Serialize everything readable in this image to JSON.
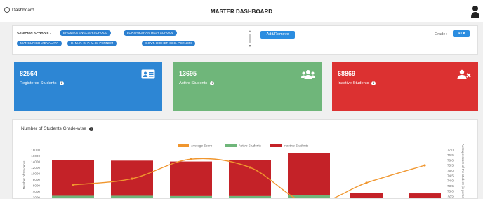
{
  "header": {
    "breadcrumb": "Dashboard",
    "title": "MASTER DASHBOARD",
    "breadcrumb_icon": "dashboard-icon",
    "avatar_icon": "user-avatar-icon"
  },
  "filter": {
    "selected_label": "Selected Schools -",
    "schools": [
      "BHUMIKA ENGLISH SCHOOL",
      "LOKSHIKSHAN HIGH SCHOOL",
      "MANGURISH VIDYALAYA",
      "H. M. P. G. P. M. S. PERNEM",
      "GOVT. HIGHER SEC. PERNEM"
    ],
    "add_remove_label": "Add/Remove",
    "grade_label": "Grade :",
    "grade_value": "All"
  },
  "cards": [
    {
      "value": "82564",
      "label": "Registered Students",
      "icon": "id-card-icon",
      "color": "#2d86d4"
    },
    {
      "value": "13695",
      "label": "Active Students",
      "icon": "users-group-icon",
      "color": "#6fb67a"
    },
    {
      "value": "68869",
      "label": "Inactive Students",
      "icon": "user-remove-icon",
      "color": "#dc3131"
    }
  ],
  "chart_panel": {
    "title": "Number of Students Grade-wise"
  },
  "chart_data": {
    "type": "bar",
    "legend_position": "top",
    "series": [
      {
        "name": "Average Score",
        "type": "line",
        "color": "#f0962e",
        "axis": "right",
        "values": [
          73.6,
          74.2,
          76.1,
          75.3,
          71.8,
          73.8,
          75.5,
          76.7
        ]
      },
      {
        "name": "Active Students",
        "type": "bar",
        "color": "#6fb67a",
        "axis": "left",
        "values": [
          2600,
          2600,
          2500,
          2500,
          2700,
          0,
          0
        ]
      },
      {
        "name": "Inactive Students",
        "type": "bar",
        "color": "#c42228",
        "axis": "left",
        "values": [
          11900,
          11800,
          11600,
          12200,
          14200,
          3600,
          3400
        ]
      }
    ],
    "ylabel": "Number of Students",
    "y2label": "Average score of the student (in perce",
    "ylim": [
      0,
      18000
    ],
    "y2lim": [
      72.5,
      77.0
    ],
    "yticks": [
      "18000",
      "16000",
      "14000",
      "12000",
      "10000",
      "8000",
      "6000",
      "4000",
      "2000"
    ],
    "y2ticks": [
      "77.0",
      "76.5",
      "76.0",
      "75.5",
      "75.0",
      "74.5",
      "74.0",
      "73.5",
      "73.0",
      "72.5"
    ]
  }
}
